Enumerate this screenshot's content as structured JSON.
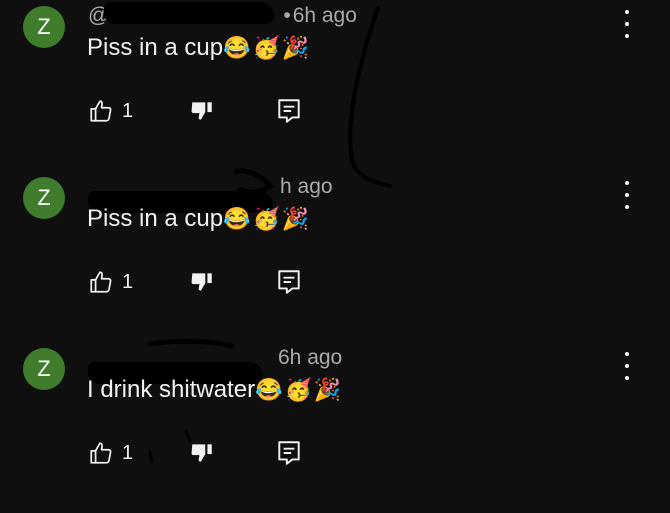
{
  "comments": [
    {
      "avatar_letter": "Z",
      "handle": "@",
      "time": "6h ago",
      "text": "Piss in a cup",
      "emojis": "😂🥳🎉",
      "likes": "1"
    },
    {
      "avatar_letter": "Z",
      "handle": "",
      "time": "h ago",
      "text": "Piss in a cup",
      "emojis": "😂🥳🎉",
      "likes": "1"
    },
    {
      "avatar_letter": "Z",
      "handle": "",
      "time": "6h ago",
      "text": "I drink shitwater",
      "emojis": "😂🥳🎉",
      "likes": "1"
    }
  ],
  "icons": {
    "like": "thumbs-up-icon",
    "dislike": "thumbs-down-icon",
    "reply": "reply-comment-icon",
    "menu": "more-vert-icon"
  },
  "colors": {
    "background": "#0f0f0f",
    "avatar": "#3f7d2c",
    "text": "#f1f1f1",
    "meta": "#aaaaaa"
  }
}
